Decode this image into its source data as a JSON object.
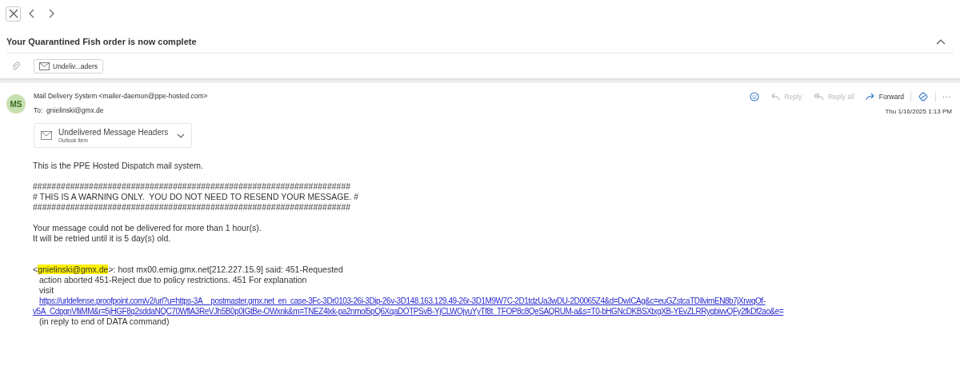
{
  "subject": "Your Quarantined Fish order is now complete",
  "attachment_chip": {
    "label": "Undeliv...aders"
  },
  "message": {
    "avatar": "MS",
    "sender_name": "Mail Delivery System",
    "sender_address": "<mailer-daemon@ppe-hosted.com>",
    "to_label": "To:",
    "to": "gnielinski@gmx.de",
    "date": "Thu 1/16/2025 1:13 PM",
    "actions": [
      {
        "kind": "emoji"
      },
      {
        "kind": "reply",
        "label": "Reply",
        "disabled": true
      },
      {
        "kind": "reply_all",
        "label": "Reply all",
        "disabled": true
      },
      {
        "kind": "forward",
        "label": "Forward",
        "disabled": false
      },
      {
        "kind": "loop"
      },
      {
        "kind": "more",
        "label": "···"
      }
    ],
    "attachment": {
      "name": "Undelivered Message Headers",
      "type": "Outlook Item"
    },
    "body": [
      {
        "kind": "para",
        "lines": [
          "This is the PPE Hosted Dispatch mail system."
        ]
      },
      {
        "kind": "para",
        "lines": [
          "####################################################################",
          "# THIS IS A WARNING ONLY.  YOU DO NOT NEED TO RESEND YOUR MESSAGE. #",
          "####################################################################"
        ]
      },
      {
        "kind": "para",
        "lines": [
          "Your message could not be delivered for more than 1 hour(s).",
          "It will be retried until it is 5 day(s) old."
        ]
      },
      {
        "kind": "gap"
      },
      {
        "kind": "bounce",
        "open": "<",
        "address": "gnielinski@gmx.de",
        "rest": ">: host mx00.emig.gmx.net[212.227.15.9] said: 451-Requested",
        "lines": [
          "action aborted 451-Reject due to policy restrictions. 451 For explanation",
          "visit"
        ],
        "link": [
          "https://urldefense.proofpoint.com/v2/url?u=https-3A__postmaster.gmx.net_en_case-3Fc-3Dr0103-26i-3Dip-26v-3D148.163.129.49-26r-3D1M9W7C-2D1tdzUa3wDU-2D0065Z4&d=DwICAg&c=euGZstcaTDIlvimEN8b7jXrwqOf-",
          "v5A_CdpgnVfiiMM&r=5jHGF8q2sddaNQC70WflA3ReVJh5B0p0IGtBe-OWxnk&m=TNEZ4lxk-pa2nmol5pQ6XqaDOTPSvB-YjCLWOjyuYyTf8t_TFOP8c8QeSAQRUM-a&s=T0-bHGNcDKBSXtxgXB-YEvZLRRyqbivvQFy2fkDf2ao&e="
        ],
        "after": "(in reply to end of DATA command)"
      }
    ]
  }
}
